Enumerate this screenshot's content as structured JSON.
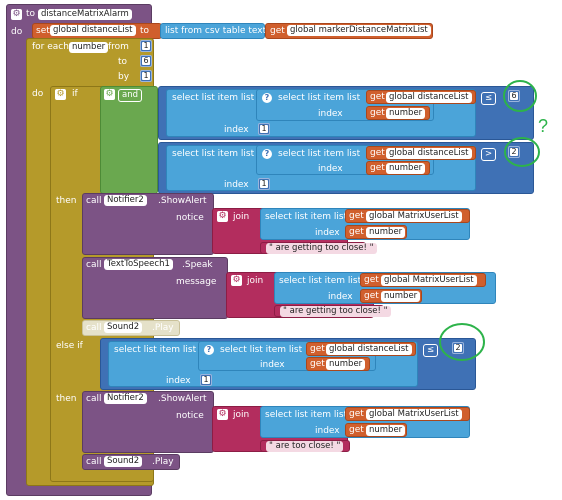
{
  "event": {
    "to": "to",
    "name": "distanceMatrixAlarm",
    "do": "do"
  },
  "set_block": {
    "set": "set",
    "var": "global distanceList",
    "to": "to"
  },
  "csv": {
    "label": "list from csv table  text",
    "get": "get",
    "var": "global markerDistanceMatrixList"
  },
  "foreach": {
    "label": "for each",
    "var": "number",
    "from": "from",
    "to": "to",
    "by": "by",
    "from_val": "1",
    "to_val": "6",
    "by_val": "1",
    "do": "do"
  },
  "if_block": {
    "if": "if",
    "and": "and",
    "then": "then",
    "elseif": "else if"
  },
  "sli": {
    "outer": "select list item  list",
    "inner": "select list item  list",
    "index": "index",
    "get": "get",
    "dist": "global distanceList",
    "number": "number",
    "one": "1"
  },
  "cmp1": {
    "op": "≤",
    "val": "6"
  },
  "cmp2": {
    "op": ">",
    "val": "2"
  },
  "cmp3": {
    "op": "≤",
    "val": "2"
  },
  "alert1": {
    "call": "call",
    "comp": "Notifier2",
    "method": ".ShowAlert",
    "param": "notice"
  },
  "speak": {
    "call": "call",
    "comp": "TextToSpeech1",
    "method": ".Speak",
    "param": "message"
  },
  "sound1": {
    "call": "call",
    "comp": "Sound2",
    "method": ".Play"
  },
  "join1": {
    "join": "join",
    "sel": "select list item  list",
    "get": "get",
    "list": "global MatrixUserList",
    "index": "index",
    "number": "number",
    "text": "\" are getting too close! \""
  },
  "join2": {
    "join": "join",
    "sel": "select list item  list",
    "get": "get",
    "list": "global MatrixUserList",
    "index": "index",
    "number": "number",
    "text": "\" are getting too close! \""
  },
  "alert2": {
    "call": "call",
    "comp": "Notifier2",
    "method": ".ShowAlert",
    "param": "notice"
  },
  "join3": {
    "join": "join",
    "sel": "select list item  list",
    "get": "get",
    "list": "global MatrixUserList",
    "index": "index",
    "number": "number",
    "text": "\" are  too close! \""
  },
  "sound2": {
    "call": "call",
    "comp": "Sound2",
    "method": ".Play"
  },
  "annotation": {
    "mark": "?"
  },
  "colors": {
    "proc": "#7c5385",
    "control": "#b59a2a",
    "variable": "#d05f2d",
    "lists": "#4ba4d9",
    "logic": "#6aa84f",
    "math": "#3f71b5",
    "text": "#b32d5e",
    "annotation": "#2db34a"
  }
}
